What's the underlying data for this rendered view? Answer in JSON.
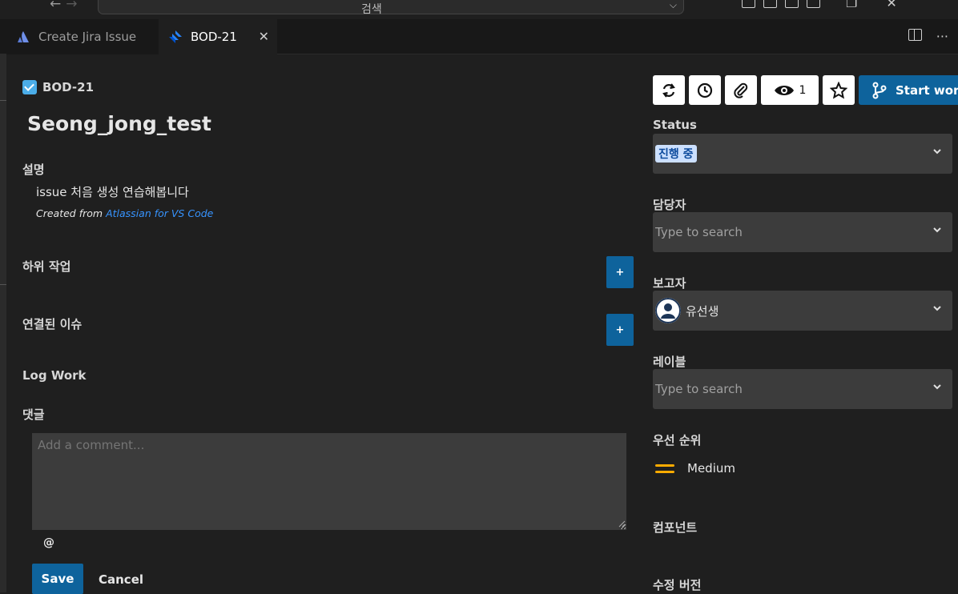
{
  "titlebar": {
    "search_label": "검색"
  },
  "tabs": [
    {
      "label": "Create Jira Issue"
    },
    {
      "label": "BOD-21"
    }
  ],
  "issue": {
    "key": "BOD-21",
    "title": "Seong_jong_test"
  },
  "description": {
    "label": "설명",
    "text": "issue 처음 생성 연습해봅니다",
    "created_prefix": "Created from",
    "created_link": "Atlassian for VS Code"
  },
  "subtasks": {
    "label": "하위 작업",
    "add": "+"
  },
  "linked_issues": {
    "label": "연결된 이슈",
    "add": "+"
  },
  "log_work": {
    "label": "Log Work"
  },
  "comments": {
    "label": "댓글",
    "placeholder": "Add a comment...",
    "mention": "@",
    "save": "Save",
    "cancel": "Cancel"
  },
  "toolbar": {
    "watchers_count": "1",
    "start_work": "Start work"
  },
  "fields": {
    "status": {
      "label": "Status",
      "value": "진행 중"
    },
    "assignee": {
      "label": "담당자",
      "placeholder": "Type to search"
    },
    "reporter": {
      "label": "보고자",
      "value": "유선생"
    },
    "labels": {
      "label": "레이블",
      "placeholder": "Type to search"
    },
    "priority": {
      "label": "우선 순위",
      "value": "Medium"
    },
    "components": {
      "label": "컴포넌트"
    },
    "fix_version": {
      "label": "수정 버전"
    }
  },
  "colors": {
    "accent": "#0e639c",
    "link": "#3794ff",
    "priority_medium": "#ffab00",
    "status_badge_bg": "#cce0ff"
  }
}
